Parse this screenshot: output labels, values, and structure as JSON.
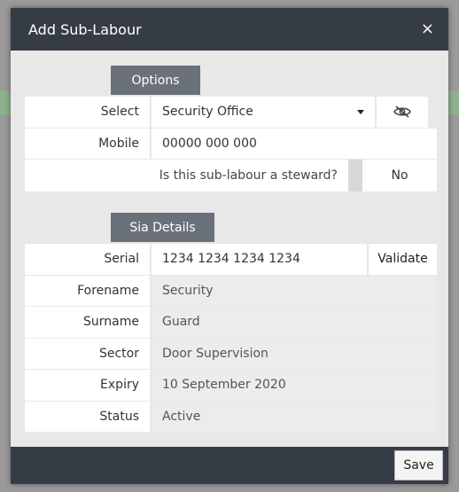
{
  "modal": {
    "title": "Add Sub-Labour",
    "close_symbol": "×",
    "save_label": "Save"
  },
  "options": {
    "tab_label": "Options",
    "select_label": "Select",
    "select_value": "Security Office",
    "mobile_label": "Mobile",
    "mobile_value": "00000 000 000",
    "steward_question": "Is this sub-labour a steward?",
    "steward_value": "No"
  },
  "sia": {
    "tab_label": "Sia Details",
    "serial_label": "Serial",
    "serial_value": "1234 1234 1234 1234",
    "validate_label": "Validate",
    "forename_label": "Forename",
    "forename_value": "Security",
    "surname_label": "Surname",
    "surname_value": "Guard",
    "sector_label": "Sector",
    "sector_value": "Door Supervision",
    "expiry_label": "Expiry",
    "expiry_value": "10 September 2020",
    "status_label": "Status",
    "status_value": "Active"
  },
  "icons": {
    "close": "close-icon",
    "dropdown": "chevron-down-icon",
    "visibility": "eye-slash-icon"
  },
  "colors": {
    "header": "#363c46",
    "section_tab": "#6b717a",
    "body": "#e8e8e8"
  }
}
